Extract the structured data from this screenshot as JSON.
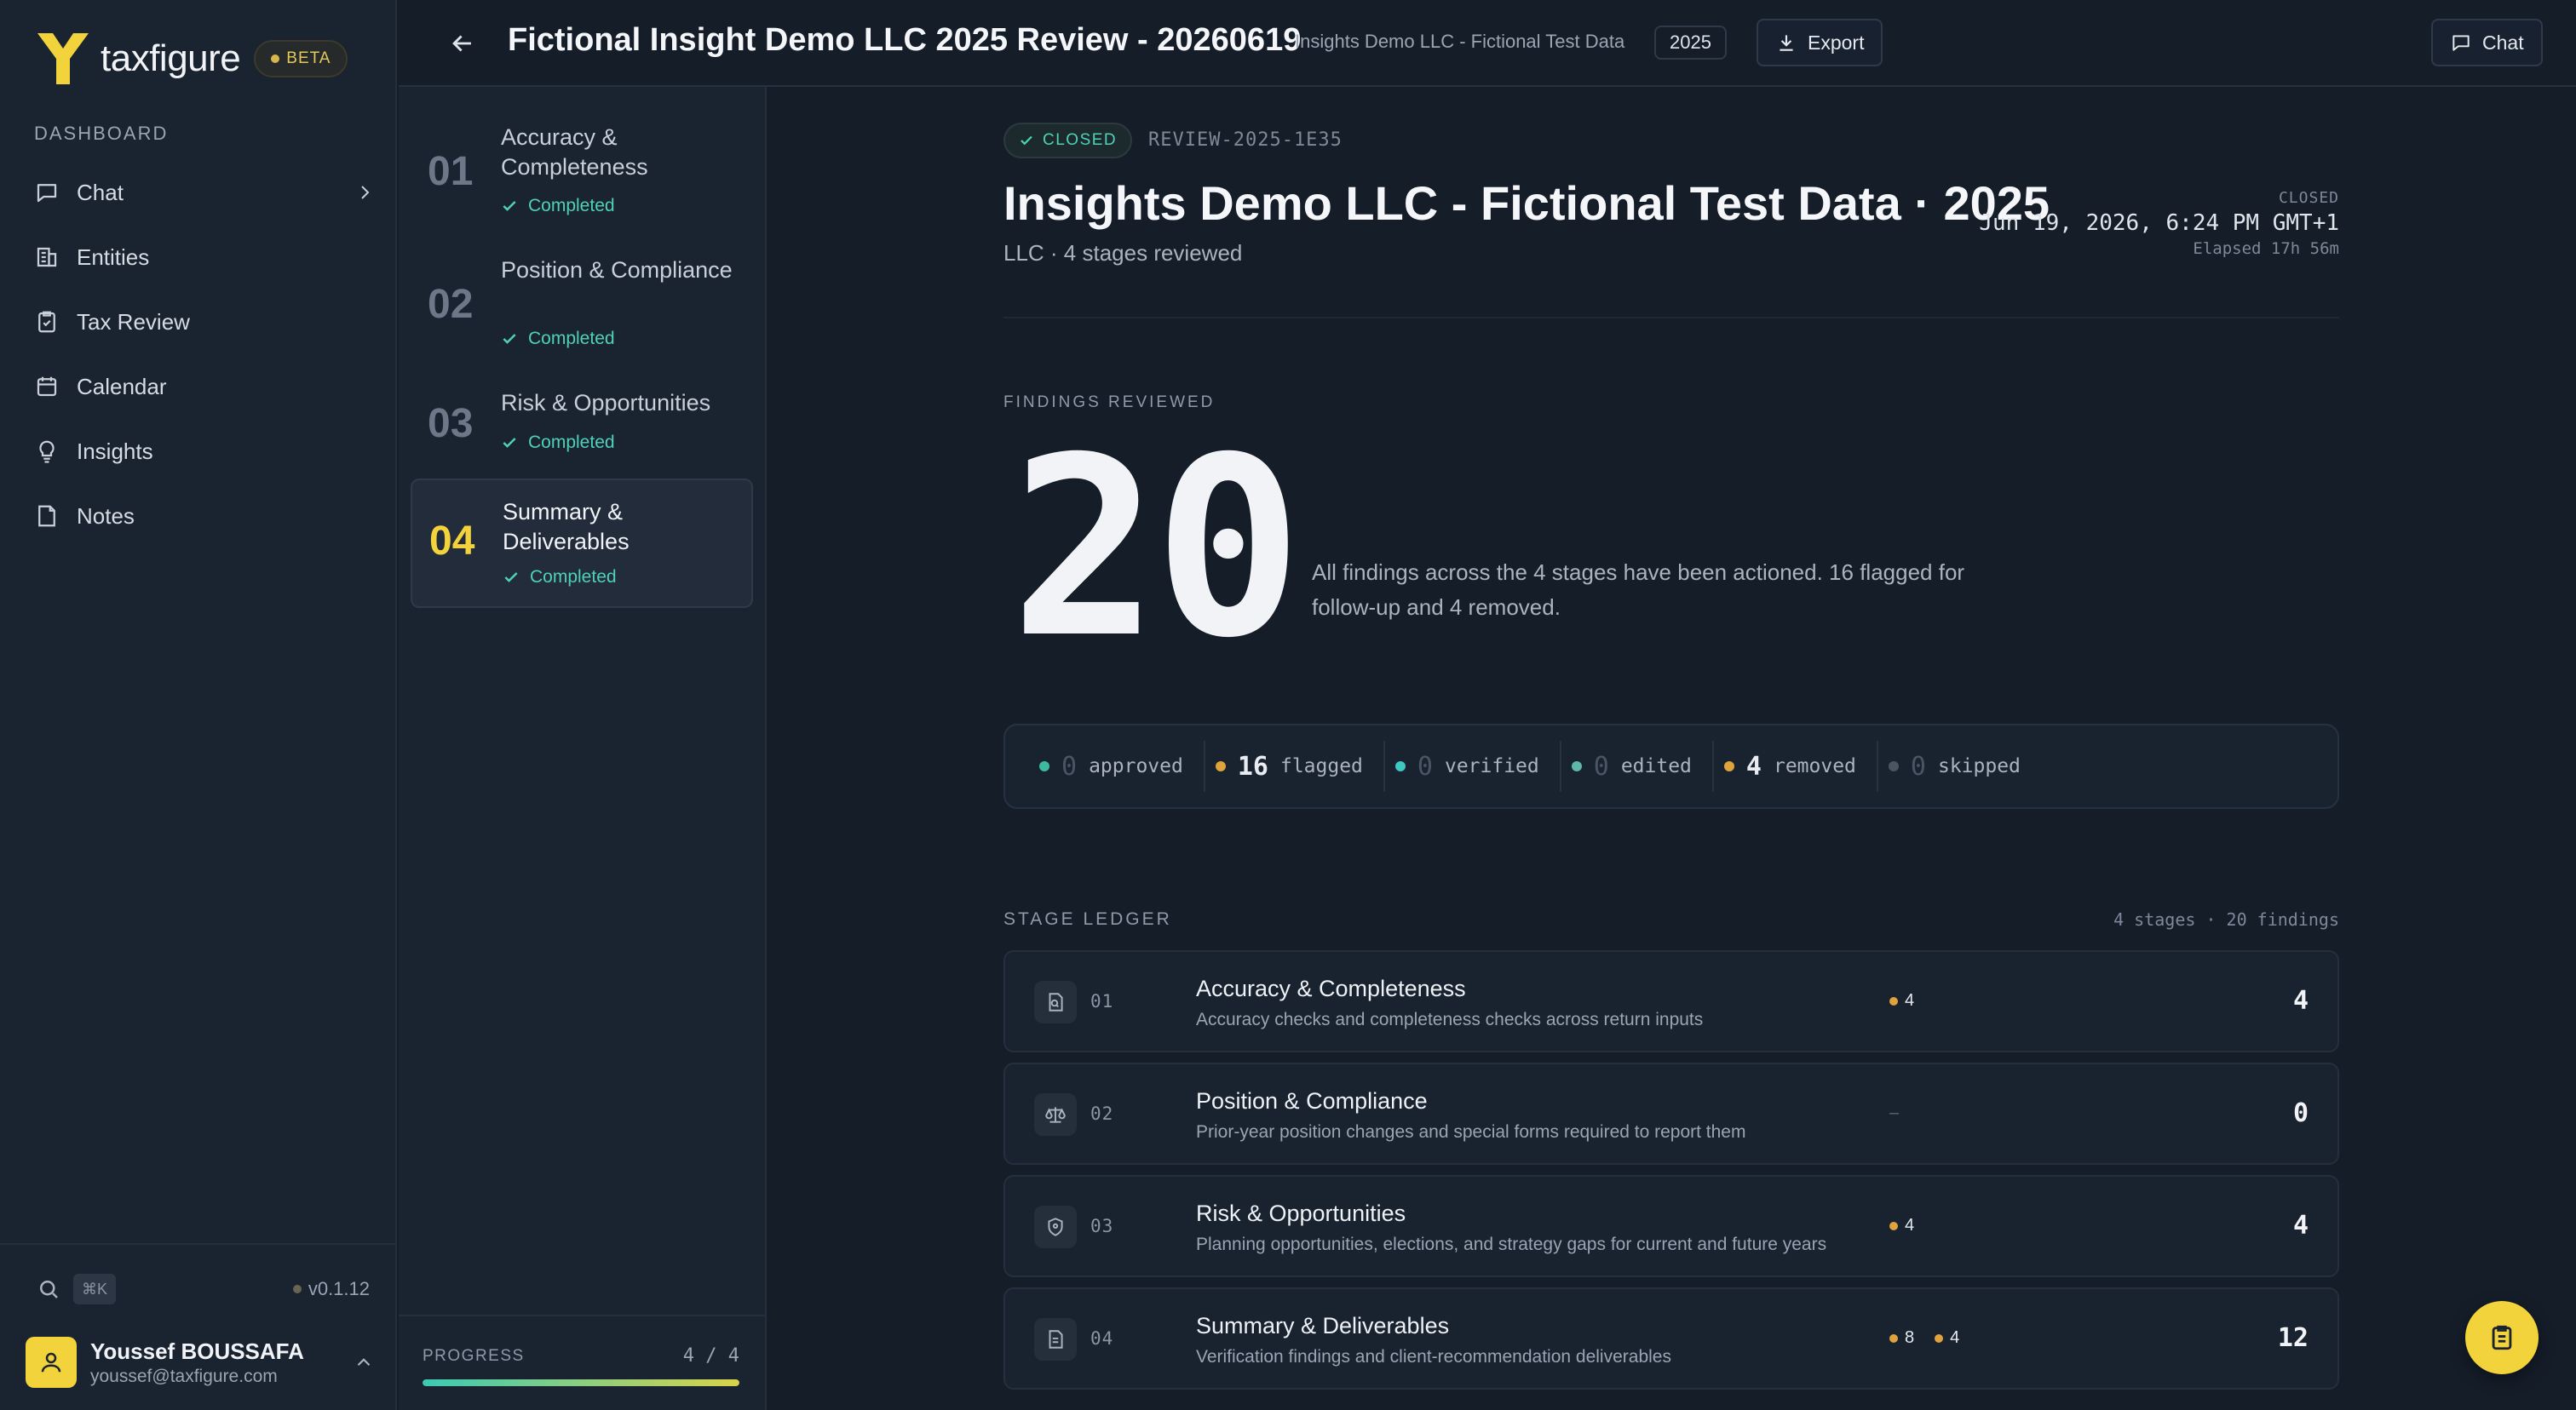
{
  "app": {
    "brand": "taxfigure",
    "beta": "BETA",
    "version": "v0.1.12",
    "shortcut": "⌘K"
  },
  "sidebar": {
    "section_label": "DASHBOARD",
    "items": [
      {
        "label": "Chat",
        "icon": "chat-icon"
      },
      {
        "label": "Entities",
        "icon": "building-icon"
      },
      {
        "label": "Tax Review",
        "icon": "clipboard-check-icon"
      },
      {
        "label": "Calendar",
        "icon": "calendar-icon"
      },
      {
        "label": "Insights",
        "icon": "lightbulb-icon"
      },
      {
        "label": "Notes",
        "icon": "note-icon"
      }
    ]
  },
  "user": {
    "name": "Youssef BOUSSAFA",
    "email": "youssef@taxfigure.com"
  },
  "header": {
    "title": "Fictional Insight Demo LLC 2025 Review - 20260619",
    "subtitle": "Insights Demo LLC - Fictional Test Data",
    "year": "2025",
    "export_label": "Export",
    "chat_label": "Chat"
  },
  "stages": [
    {
      "num": "01",
      "title": "Accuracy & Completeness",
      "status": "Completed"
    },
    {
      "num": "02",
      "title": "Position & Compliance",
      "status": "Completed"
    },
    {
      "num": "03",
      "title": "Risk & Opportunities",
      "status": "Completed"
    },
    {
      "num": "04",
      "title": "Summary & Deliverables",
      "status": "Completed"
    }
  ],
  "progress": {
    "label": "PROGRESS",
    "count": "4 / 4",
    "fraction": 1.0
  },
  "review": {
    "status": "CLOSED",
    "id": "REVIEW-2025-1E35",
    "entity_title": "Insights Demo LLC - Fictional Test Data · 2025",
    "entity_sub": "LLC · 4 stages reviewed",
    "meta_label": "CLOSED",
    "meta_date": "Jun 19, 2026, 6:24 PM GMT+1",
    "meta_elapsed": "Elapsed 17h 56m"
  },
  "findings": {
    "label": "FINDINGS REVIEWED",
    "total": "20",
    "description": "All findings across the 4 stages have been actioned. 16 flagged for follow-up and 4 removed."
  },
  "counters": [
    {
      "num": "0",
      "label": "approved",
      "color": "#3fb8a0"
    },
    {
      "num": "16",
      "label": "flagged",
      "color": "#e0a23c"
    },
    {
      "num": "0",
      "label": "verified",
      "color": "#3fc7c0"
    },
    {
      "num": "0",
      "label": "edited",
      "color": "#5fb7a8"
    },
    {
      "num": "4",
      "label": "removed",
      "color": "#e0a23c"
    },
    {
      "num": "0",
      "label": "skipped",
      "color": "#4a5463"
    }
  ],
  "ledger": {
    "label": "STAGE LEDGER",
    "meta": "4 stages · 20 findings",
    "rows": [
      {
        "num": "01",
        "title": "Accuracy & Completeness",
        "desc": "Accuracy checks and completeness checks across return inputs",
        "tags": [
          "4"
        ],
        "total": "4",
        "icon": "document-search-icon"
      },
      {
        "num": "02",
        "title": "Position & Compliance",
        "desc": "Prior-year position changes and special forms required to report them",
        "tags": [],
        "dash": "–",
        "total": "0",
        "icon": "scale-icon"
      },
      {
        "num": "03",
        "title": "Risk & Opportunities",
        "desc": "Planning opportunities, elections, and strategy gaps for current and future years",
        "tags": [
          "4"
        ],
        "total": "4",
        "icon": "shield-icon"
      },
      {
        "num": "04",
        "title": "Summary & Deliverables",
        "desc": "Verification findings and client-recommendation deliverables",
        "tags": [
          "8",
          "4"
        ],
        "total": "12",
        "icon": "document-icon"
      }
    ]
  },
  "colors": {
    "accent": "#f2d33b",
    "success": "#4fd1b8",
    "warning": "#e0a23c"
  }
}
